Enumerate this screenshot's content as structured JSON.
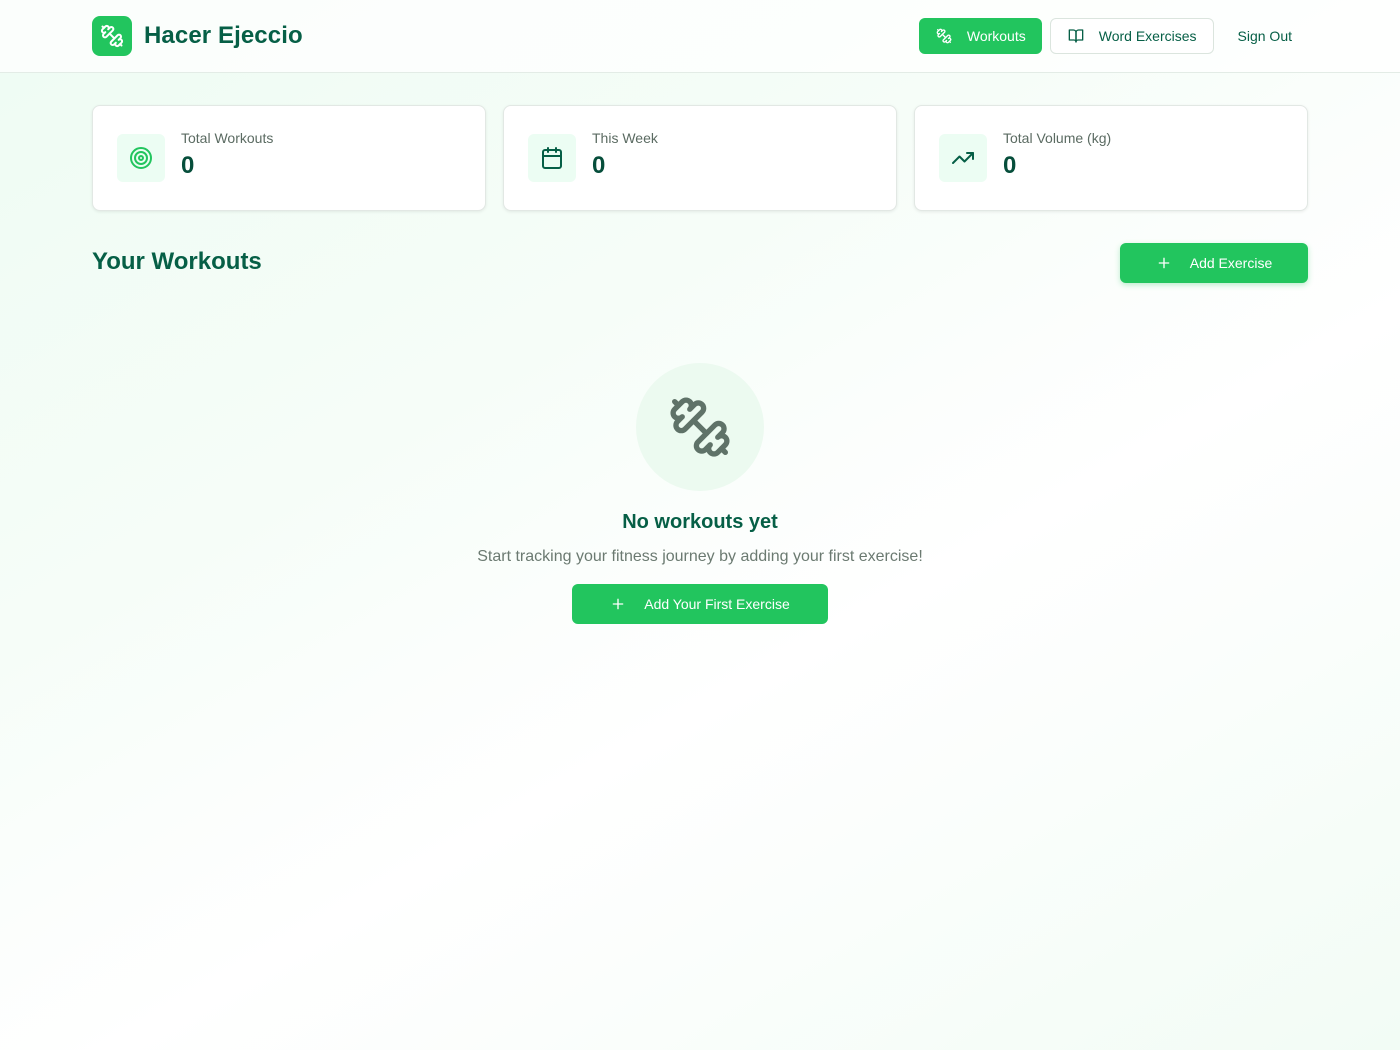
{
  "app": {
    "name": "Hacer Ejeccio",
    "logo_icon": "dumbbell-icon"
  },
  "nav": {
    "workouts": "Workouts",
    "word_exercises": "Word Exercises",
    "sign_out": "Sign Out"
  },
  "stats": [
    {
      "label": "Total Workouts",
      "value": "0",
      "icon": "target-icon"
    },
    {
      "label": "This Week",
      "value": "0",
      "icon": "calendar-icon"
    },
    {
      "label": "Total Volume (kg)",
      "value": "0",
      "icon": "trending-up-icon"
    }
  ],
  "section": {
    "title": "Your Workouts",
    "add_label": "Add Exercise"
  },
  "empty_state": {
    "title": "No workouts yet",
    "subtitle": "Start tracking your fitness journey by adding your first exercise!",
    "cta_label": "Add Your First Exercise"
  },
  "colors": {
    "accent": "#22c55e",
    "text_dark": "#065f46"
  }
}
